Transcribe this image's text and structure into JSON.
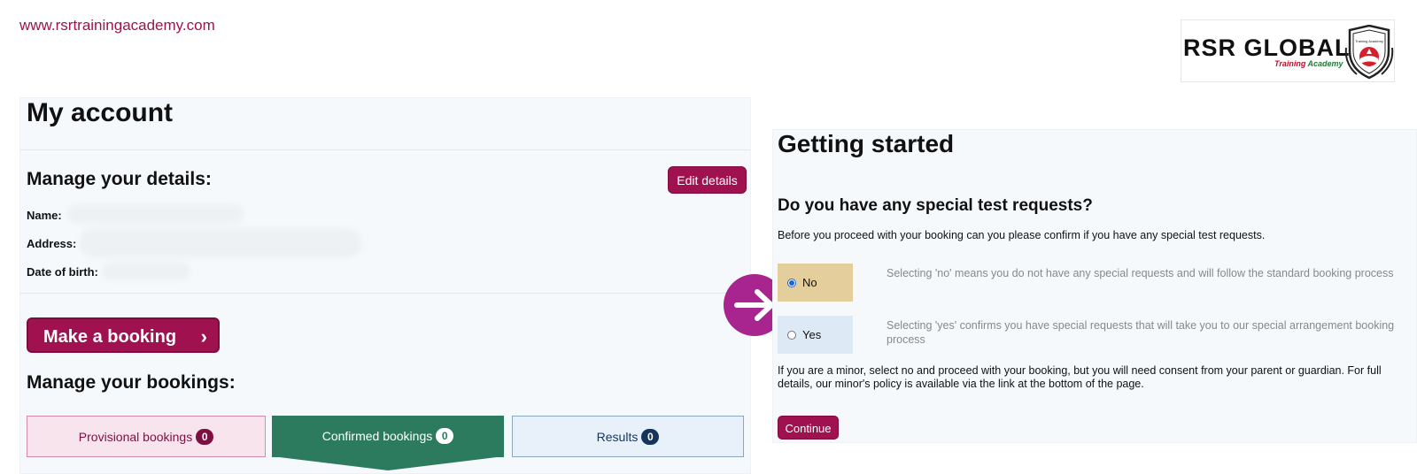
{
  "site_url": "www.rsrtrainingacademy.com",
  "logo": {
    "title": "RSR GLOBAL",
    "subtitle_part1": "Training",
    "subtitle_part2": "Academy",
    "emblem_text": "Training Academy"
  },
  "account": {
    "title": "My account",
    "details_heading": "Manage your details:",
    "edit_label": "Edit details",
    "fields": {
      "name_label": "Name:",
      "address_label": "Address:",
      "dob_label": "Date of birth:"
    },
    "make_booking_label": "Make a booking",
    "bookings_heading": "Manage your bookings:",
    "tabs": [
      {
        "label": "Provisional bookings",
        "count": "0"
      },
      {
        "label": "Confirmed bookings",
        "count": "0"
      },
      {
        "label": "Results",
        "count": "0"
      }
    ]
  },
  "arrow_icon": "right-arrow-icon",
  "getting_started": {
    "title": "Getting started",
    "question": "Do you have any special test requests?",
    "intro": "Before you proceed with your booking can you please confirm if you have any special test requests.",
    "options": [
      {
        "label": "No",
        "selected": true,
        "description": "Selecting 'no' means you do not have any special requests and will follow the standard booking process"
      },
      {
        "label": "Yes",
        "selected": false,
        "description": "Selecting 'yes' confirms you have special requests that will take you to our special arrangement booking process"
      }
    ],
    "note": "If you are a minor, select no and proceed with your booking, but you will need consent from your parent or guardian. For full details, our minor's policy is available via the link at the bottom of the page.",
    "continue_label": "Continue"
  },
  "colors": {
    "brand": "#a0124f",
    "confirmed_tab": "#2d7b5e",
    "arrow_circle": "#a8248f",
    "no_option_bg": "#e4cf9c",
    "yes_option_bg": "#dde9f5"
  }
}
